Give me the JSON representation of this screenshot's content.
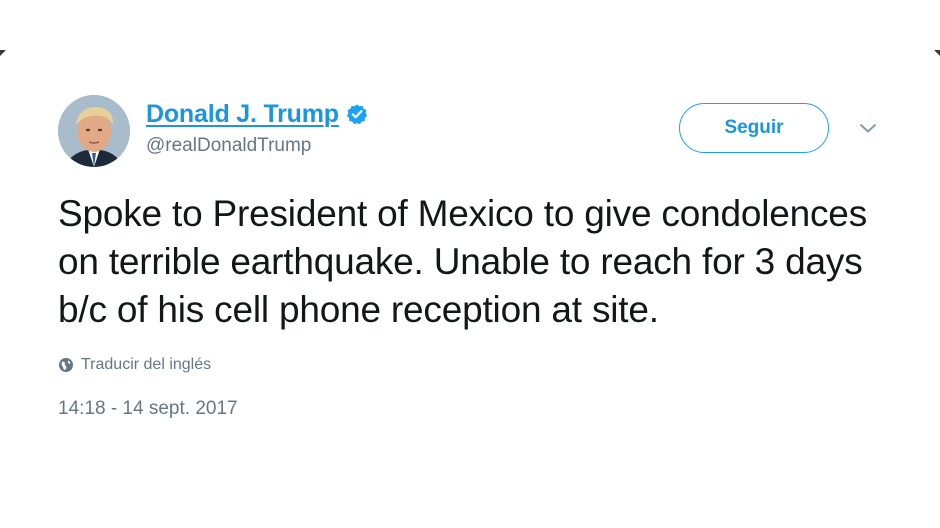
{
  "tweet": {
    "author": {
      "display_name": "Donald J. Trump",
      "handle": "@realDonaldTrump",
      "verified": true
    },
    "follow_label": "Seguir",
    "text": "Spoke to President of Mexico to give condolences on terrible earthquake. Unable to reach for 3 days b/c of his cell phone reception at site.",
    "translate_label": "Traducir del inglés",
    "timestamp": "14:18 - 14 sept. 2017"
  },
  "icons": {
    "verified": "verified-badge-icon",
    "menu": "chevron-down-icon",
    "translate": "globe-icon"
  },
  "colors": {
    "accent": "#1da1f2",
    "link": "#1b95e0",
    "text": "#14171a",
    "muted": "#657786"
  }
}
